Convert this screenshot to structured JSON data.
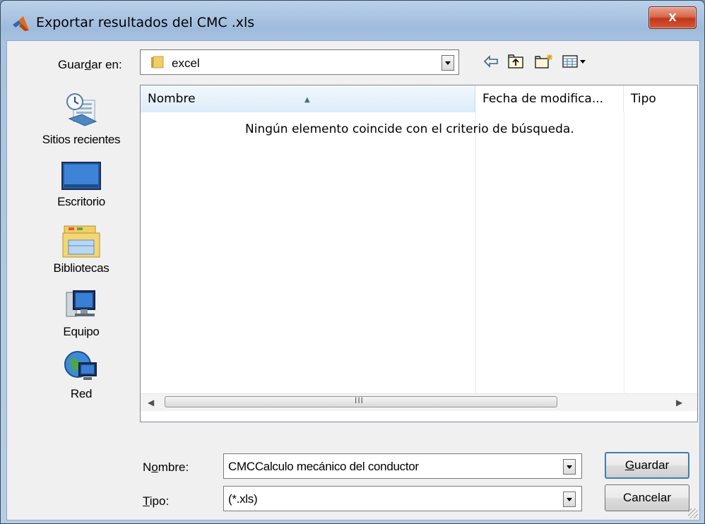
{
  "window": {
    "title": "Exportar resultados del CMC .xls",
    "close_label": "x"
  },
  "save_in": {
    "label_pre": "Guar",
    "label_accel": "d",
    "label_post": "ar en:",
    "value": "excel"
  },
  "places": [
    {
      "label": "Sitios recientes",
      "icon": "recent-places-icon"
    },
    {
      "label": "Escritorio",
      "icon": "desktop-icon"
    },
    {
      "label": "Bibliotecas",
      "icon": "libraries-icon"
    },
    {
      "label": "Equipo",
      "icon": "computer-icon"
    },
    {
      "label": "Red",
      "icon": "network-icon"
    }
  ],
  "file_list": {
    "columns": [
      "Nombre",
      "Fecha de modifica...",
      "Tipo"
    ],
    "empty_message": "Ningún elemento coincide con el criterio de búsqueda.",
    "scroll_grip": "III"
  },
  "filename": {
    "label_pre": "N",
    "label_accel": "o",
    "label_post": "mbre:",
    "value": "CMCCalculo mecánico del conductor"
  },
  "filetype": {
    "label_accel": "T",
    "label_post": "ipo:",
    "value": "(*.xls)"
  },
  "buttons": {
    "save_accel": "G",
    "save_post": "uardar",
    "cancel": "Cancelar"
  },
  "colors": {
    "title_gradient_top": "#b9d1ea",
    "close_red": "#c2371a",
    "header_blue": "#dcecf9",
    "default_button_border": "#3c7fb1"
  }
}
